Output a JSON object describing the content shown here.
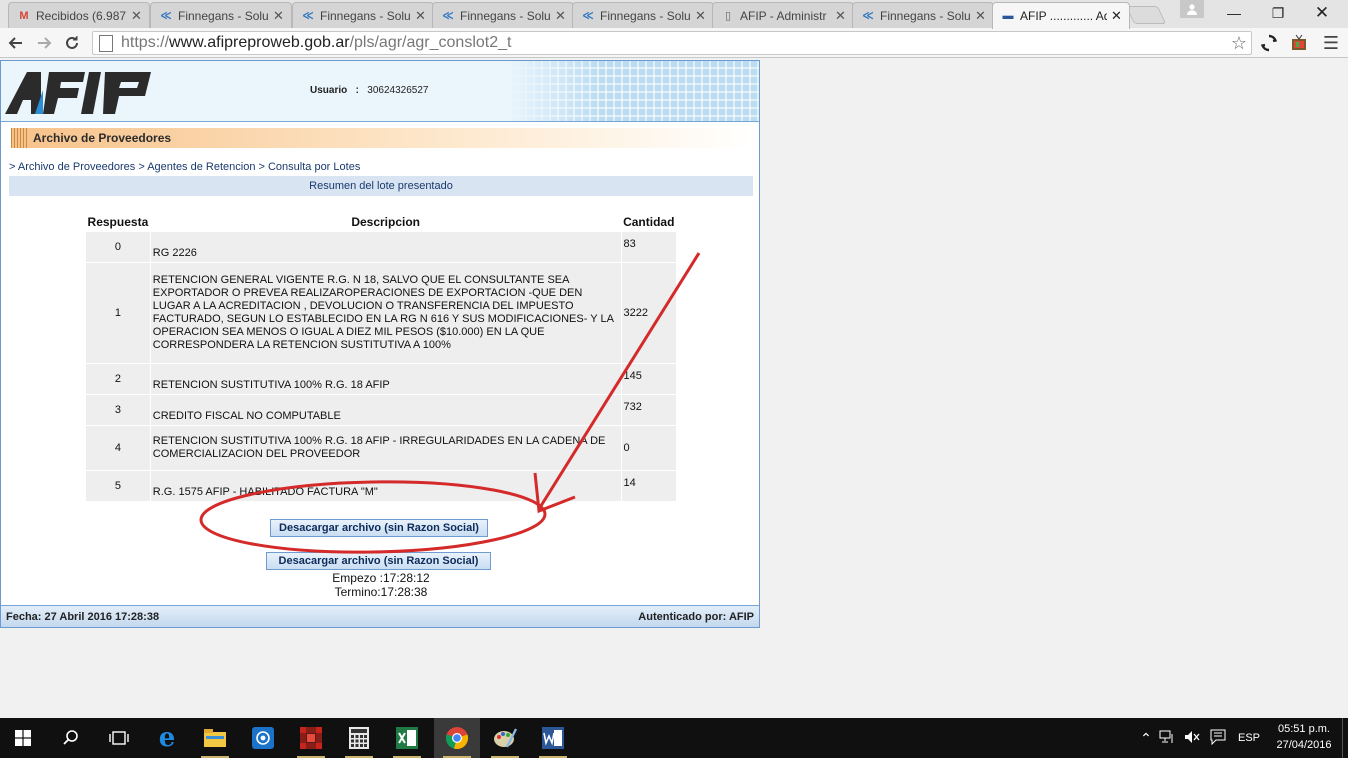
{
  "browser": {
    "tabs": [
      {
        "title": "Recibidos (6.987",
        "icon": "gmail-icon",
        "glyph": "M",
        "color": "#d44638"
      },
      {
        "title": "Finnegans - Solu",
        "icon": "finnegans-icon",
        "glyph": "≪",
        "color": "#2f76c2"
      },
      {
        "title": "Finnegans - Solu",
        "icon": "finnegans-icon",
        "glyph": "≪",
        "color": "#2f76c2"
      },
      {
        "title": "Finnegans - Solu",
        "icon": "finnegans-icon",
        "glyph": "≪",
        "color": "#2f76c2"
      },
      {
        "title": "Finnegans - Solu",
        "icon": "finnegans-icon",
        "glyph": "≪",
        "color": "#2f76c2"
      },
      {
        "title": "AFIP - Administr",
        "icon": "page-icon",
        "glyph": "▯",
        "color": "#666666"
      },
      {
        "title": "Finnegans - Solu",
        "icon": "finnegans-icon",
        "glyph": "≪",
        "color": "#2f76c2"
      },
      {
        "title": "AFIP ............. Adm",
        "icon": "afip-tab-icon",
        "glyph": "▬",
        "color": "#2b5797"
      }
    ],
    "url": {
      "scheme": "https://",
      "host": "www.afipreproweb.gob.ar",
      "path": "/pls/agr/agr_conslot2_t"
    }
  },
  "afip": {
    "logo_text": "AFIP",
    "user_label": "Usuario",
    "user_sep": ":",
    "user_value": "30624326527",
    "section_title": "Archivo de Proveedores",
    "breadcrumb": "> Archivo de Proveedores > Agentes de Retencion > Consulta por Lotes",
    "summary_title": "Resumen del lote presentado",
    "table": {
      "headers": [
        "Respuesta",
        "Descripcion",
        "Cantidad"
      ],
      "rows": [
        {
          "code": "0",
          "desc": "RG 2226",
          "qty": "83"
        },
        {
          "code": "1",
          "desc": "RETENCION GENERAL VIGENTE R.G. N 18, SALVO QUE EL CONSULTANTE SEA EXPORTADOR O PREVEA REALIZAROPERACIONES DE EXPORTACION -QUE DEN LUGAR A LA ACREDITACION , DEVOLUCION O TRANSFERENCIA DEL IMPUESTO FACTURADO, SEGUN LO ESTABLECIDO EN LA RG N 616 Y SUS MODIFICACIONES- Y LA OPERACION SEA MENOS O IGUAL A DIEZ MIL PESOS ($10.000) EN LA QUE CORRESPONDERA LA RETENCION SUSTITUTIVA A 100%",
          "qty": "3222"
        },
        {
          "code": "2",
          "desc": "RETENCION SUSTITUTIVA 100% R.G. 18 AFIP",
          "qty": "145"
        },
        {
          "code": "3",
          "desc": "CREDITO FISCAL NO COMPUTABLE",
          "qty": "732"
        },
        {
          "code": "4",
          "desc": "RETENCION SUSTITUTIVA 100% R.G. 18 AFIP - IRREGULARIDADES EN LA CADENA DE COMERCIALIZACION DEL PROVEEDOR",
          "qty": "0"
        },
        {
          "code": "5",
          "desc": "R.G. 1575 AFIP - HABILITADO FACTURA \"M\"",
          "qty": "14"
        }
      ]
    },
    "download_button_1": "Desacargar archivo (sin Razon Social)",
    "download_button_2": "Desacargar archivo (sin Razon Social)",
    "start_time": "Empezo :17:28:12",
    "end_time": "Termino:17:28:38",
    "footer_date": "Fecha: 27 Abril 2016 17:28:38",
    "footer_auth": "Autenticado por: AFIP"
  },
  "annotation_color": "#d42a2a",
  "taskbar": {
    "lang": "ESP",
    "time": "05:51 p.m.",
    "date": "27/04/2016"
  }
}
